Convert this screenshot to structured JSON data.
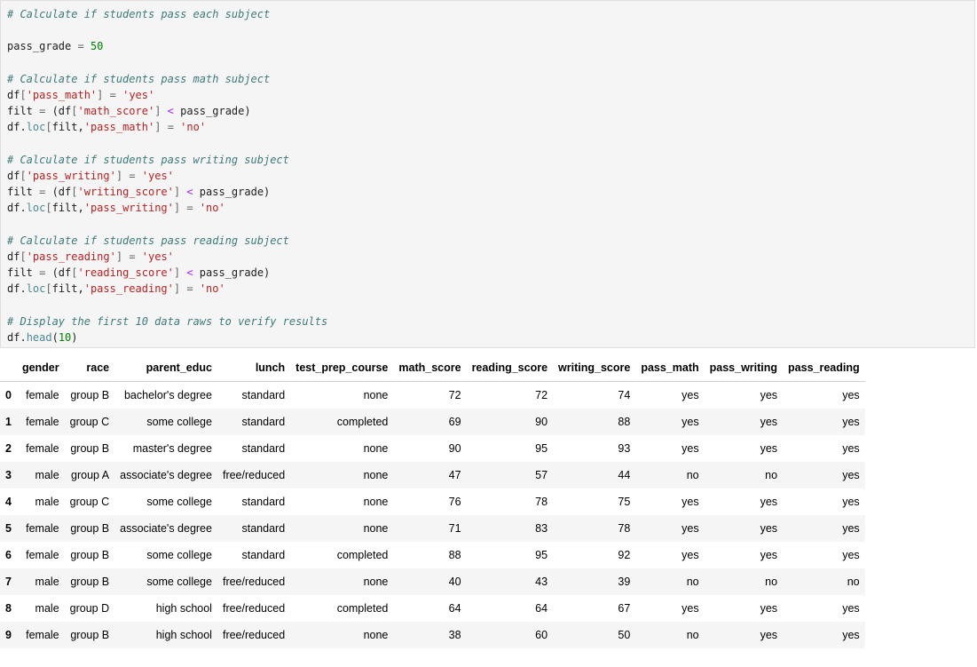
{
  "code_lines": [
    "# Calculate if students pass each subject",
    "",
    "pass_grade = 50",
    "",
    "# Calculate if students pass math subject",
    "df['pass_math'] = 'yes'",
    "filt = (df['math_score'] < pass_grade)",
    "df.loc[filt,'pass_math'] = 'no'",
    "",
    "# Calculate if students pass writing subject",
    "df['pass_writing'] = 'yes'",
    "filt = (df['writing_score'] < pass_grade)",
    "df.loc[filt,'pass_writing'] = 'no'",
    "",
    "# Calculate if students pass reading subject",
    "df['pass_reading'] = 'yes'",
    "filt = (df['reading_score'] < pass_grade)",
    "df.loc[filt,'pass_reading'] = 'no'",
    "",
    "# Display the first 10 data raws to verify results",
    "df.head(10)"
  ],
  "table": {
    "columns": [
      "",
      "gender",
      "race",
      "parent_educ",
      "lunch",
      "test_prep_course",
      "math_score",
      "reading_score",
      "writing_score",
      "pass_math",
      "pass_writing",
      "pass_reading"
    ],
    "rows": [
      [
        "0",
        "female",
        "group B",
        "bachelor's degree",
        "standard",
        "none",
        "72",
        "72",
        "74",
        "yes",
        "yes",
        "yes"
      ],
      [
        "1",
        "female",
        "group C",
        "some college",
        "standard",
        "completed",
        "69",
        "90",
        "88",
        "yes",
        "yes",
        "yes"
      ],
      [
        "2",
        "female",
        "group B",
        "master's degree",
        "standard",
        "none",
        "90",
        "95",
        "93",
        "yes",
        "yes",
        "yes"
      ],
      [
        "3",
        "male",
        "group A",
        "associate's degree",
        "free/reduced",
        "none",
        "47",
        "57",
        "44",
        "no",
        "no",
        "yes"
      ],
      [
        "4",
        "male",
        "group C",
        "some college",
        "standard",
        "none",
        "76",
        "78",
        "75",
        "yes",
        "yes",
        "yes"
      ],
      [
        "5",
        "female",
        "group B",
        "associate's degree",
        "standard",
        "none",
        "71",
        "83",
        "78",
        "yes",
        "yes",
        "yes"
      ],
      [
        "6",
        "female",
        "group B",
        "some college",
        "standard",
        "completed",
        "88",
        "95",
        "92",
        "yes",
        "yes",
        "yes"
      ],
      [
        "7",
        "male",
        "group B",
        "some college",
        "free/reduced",
        "none",
        "40",
        "43",
        "39",
        "no",
        "no",
        "no"
      ],
      [
        "8",
        "male",
        "group D",
        "high school",
        "free/reduced",
        "completed",
        "64",
        "64",
        "67",
        "yes",
        "yes",
        "yes"
      ],
      [
        "9",
        "female",
        "group B",
        "high school",
        "free/reduced",
        "none",
        "38",
        "60",
        "50",
        "no",
        "yes",
        "yes"
      ]
    ]
  }
}
